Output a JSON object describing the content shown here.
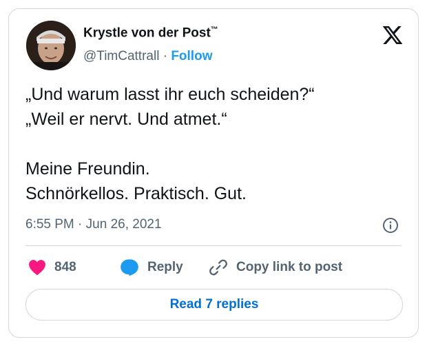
{
  "author": {
    "display_name": "Krystle von der Post",
    "name_mark": "™",
    "handle": "@TimCattrall",
    "separator": "·",
    "follow_label": "Follow",
    "avatar_icon": "profile-photo"
  },
  "brand_icon": "x-logo-icon",
  "tweet": {
    "lines": [
      "„Und warum lasst ihr euch scheiden?“",
      "„Weil er nervt. Und atmet.“",
      "",
      "Meine Freundin.",
      "Schnörkellos. Praktisch. Gut."
    ],
    "time": "6:55 PM",
    "meta_separator": "·",
    "date": "Jun 26, 2021"
  },
  "actions": {
    "like_count": "848",
    "reply_label": "Reply",
    "copy_label": "Copy link to post"
  },
  "read_replies_label": "Read 7 replies",
  "colors": {
    "link": "#1d9bf0",
    "like": "#f91880",
    "text": "#0f1419",
    "muted": "#536471",
    "border": "#cfd9de"
  }
}
